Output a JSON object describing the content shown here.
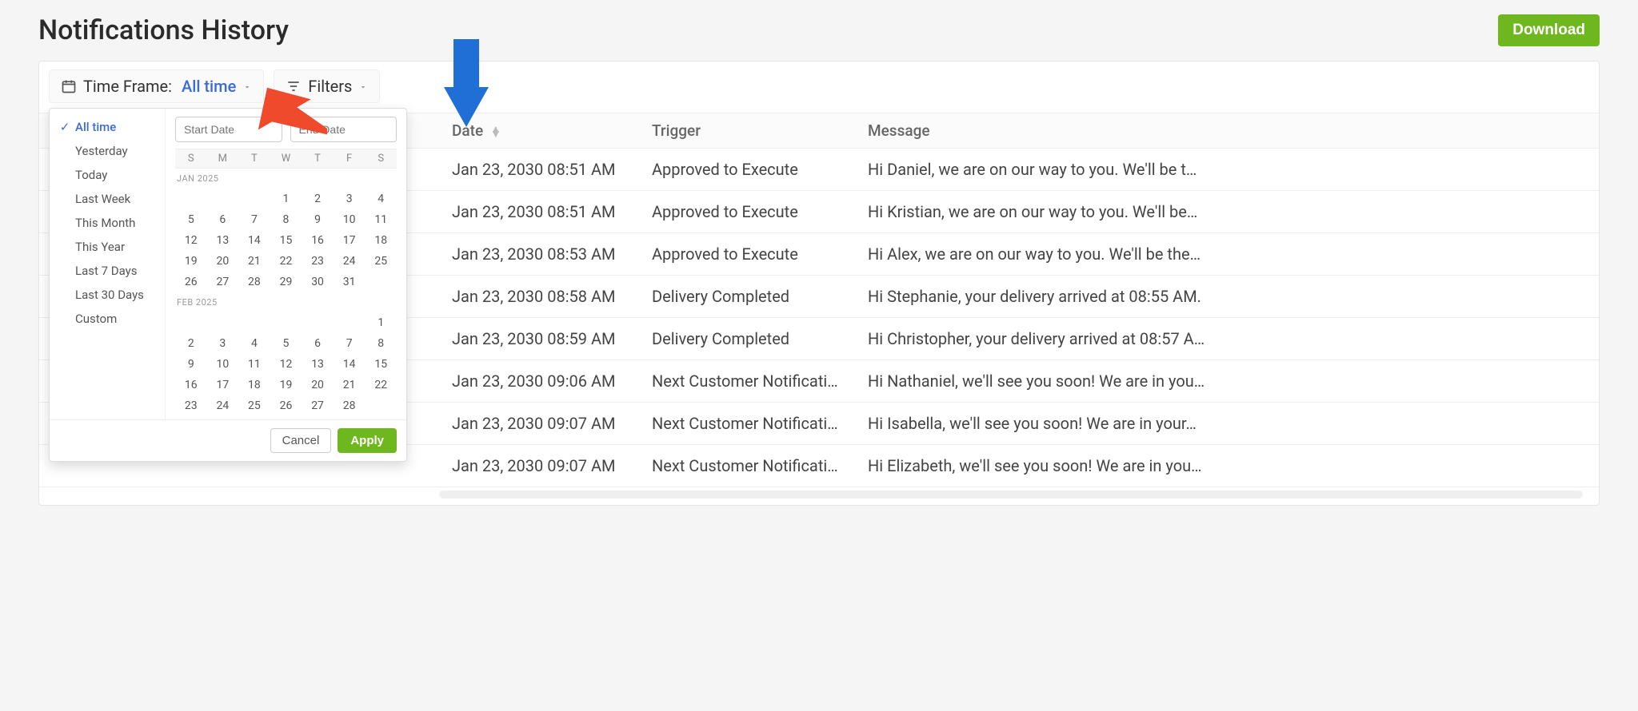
{
  "page": {
    "title": "Notifications History"
  },
  "buttons": {
    "download": "Download",
    "cancel": "Cancel",
    "apply": "Apply"
  },
  "toolbar": {
    "timeframe_label": "Time Frame:",
    "timeframe_value": "All time",
    "filters_label": "Filters"
  },
  "timeframe": {
    "presets": [
      "All time",
      "Yesterday",
      "Today",
      "Last Week",
      "This Month",
      "This Year",
      "Last 7 Days",
      "Last 30 Days",
      "Custom"
    ],
    "selected_preset": "All time",
    "start_placeholder": "Start Date",
    "end_placeholder": "End Date",
    "dow": [
      "S",
      "M",
      "T",
      "W",
      "T",
      "F",
      "S"
    ],
    "month1_label": "JAN 2025",
    "month1_start_dow": 3,
    "month1_days": 31,
    "month2_label": "FEB 2025",
    "month2_start_dow": 6,
    "month2_days": 28
  },
  "table": {
    "headers": [
      "",
      "Date",
      "Trigger",
      "Message"
    ],
    "rows": [
      {
        "date": "Jan 23, 2030 08:51 AM",
        "trigger": "Approved to Execute",
        "message": "Hi Daniel, we are on our way to you. We'll be t…"
      },
      {
        "date": "Jan 23, 2030 08:51 AM",
        "trigger": "Approved to Execute",
        "message": "Hi Kristian, we are on our way to you. We'll be…"
      },
      {
        "date": "Jan 23, 2030 08:53 AM",
        "trigger": "Approved to Execute",
        "message": "Hi Alex, we are on our way to you. We'll be the…"
      },
      {
        "date": "Jan 23, 2030 08:58 AM",
        "trigger": "Delivery Completed",
        "message": "Hi Stephanie, your delivery arrived at 08:55 AM."
      },
      {
        "date": "Jan 23, 2030 08:59 AM",
        "trigger": "Delivery Completed",
        "message": "Hi Christopher, your delivery arrived at 08:57 A…"
      },
      {
        "date": "Jan 23, 2030 09:06 AM",
        "trigger": "Next Customer Notification",
        "message": "Hi Nathaniel, we'll see you soon! We are in you…"
      },
      {
        "date": "Jan 23, 2030 09:07 AM",
        "trigger": "Next Customer Notification",
        "message": "Hi Isabella, we'll see you soon! We are in your…"
      },
      {
        "date": "Jan 23, 2030 09:07 AM",
        "trigger": "Next Customer Notification",
        "message": "Hi Elizabeth, we'll see you soon! We are in you…"
      }
    ]
  }
}
